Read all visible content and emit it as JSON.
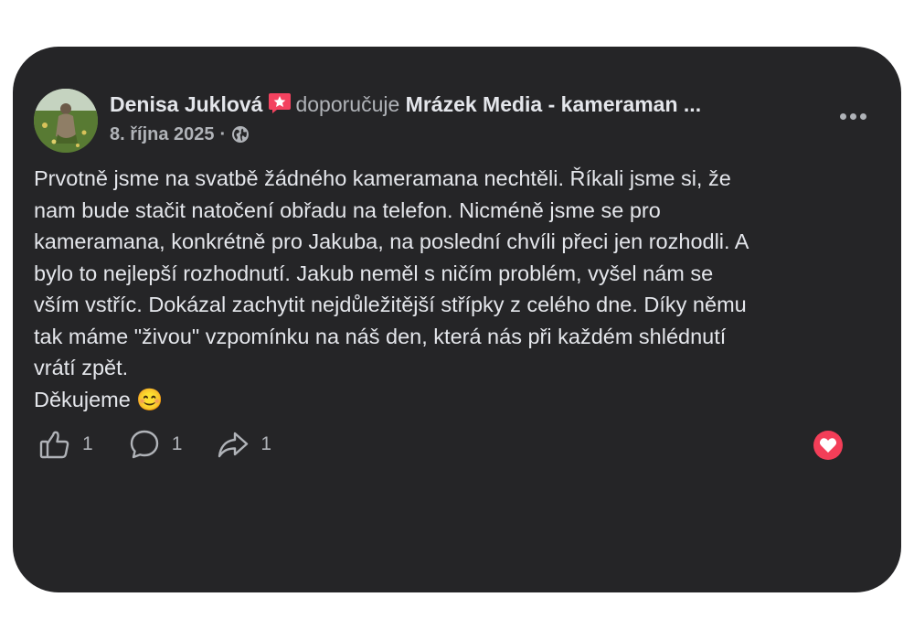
{
  "post": {
    "author_name": "Denisa Juklová",
    "badge_icon": "recommendation-star-icon",
    "verb": "doporučuje",
    "page_name": "Mrázek Media - kameraman ...",
    "date": "8. října 2025",
    "separator": "·",
    "privacy_icon": "globe-icon",
    "more_icon": "more-dots-icon",
    "text_lines": [
      "Prvotně jsme na svatbě žádného kameramana nechtěli. Říkali jsme si, že",
      "nam bude stačit natočení obřadu na telefon. Nicméně jsme se pro",
      "kameramana, konkrétně pro Jakuba, na poslední chvíli přeci jen rozhodli. A",
      "bylo to nejlepší rozhodnutí. Jakub neměl s ničím problém, vyšel nám se",
      "vším vstříc. Dokázal zachytit nejdůležitější střípky z celého dne. Díky němu",
      "tak máme \"živou\" vzpomínku na náš den, která nás při každém shlédnutí",
      "vrátí zpět.",
      "Děkujeme 😊"
    ]
  },
  "actions": {
    "like_count": "1",
    "comment_count": "1",
    "share_count": "1"
  },
  "reaction": {
    "icon": "heart-icon",
    "color": "#f33e58"
  },
  "colors": {
    "card_bg": "#252527",
    "primary_text": "#e4e6eb",
    "secondary_text": "#b0b3b8"
  }
}
